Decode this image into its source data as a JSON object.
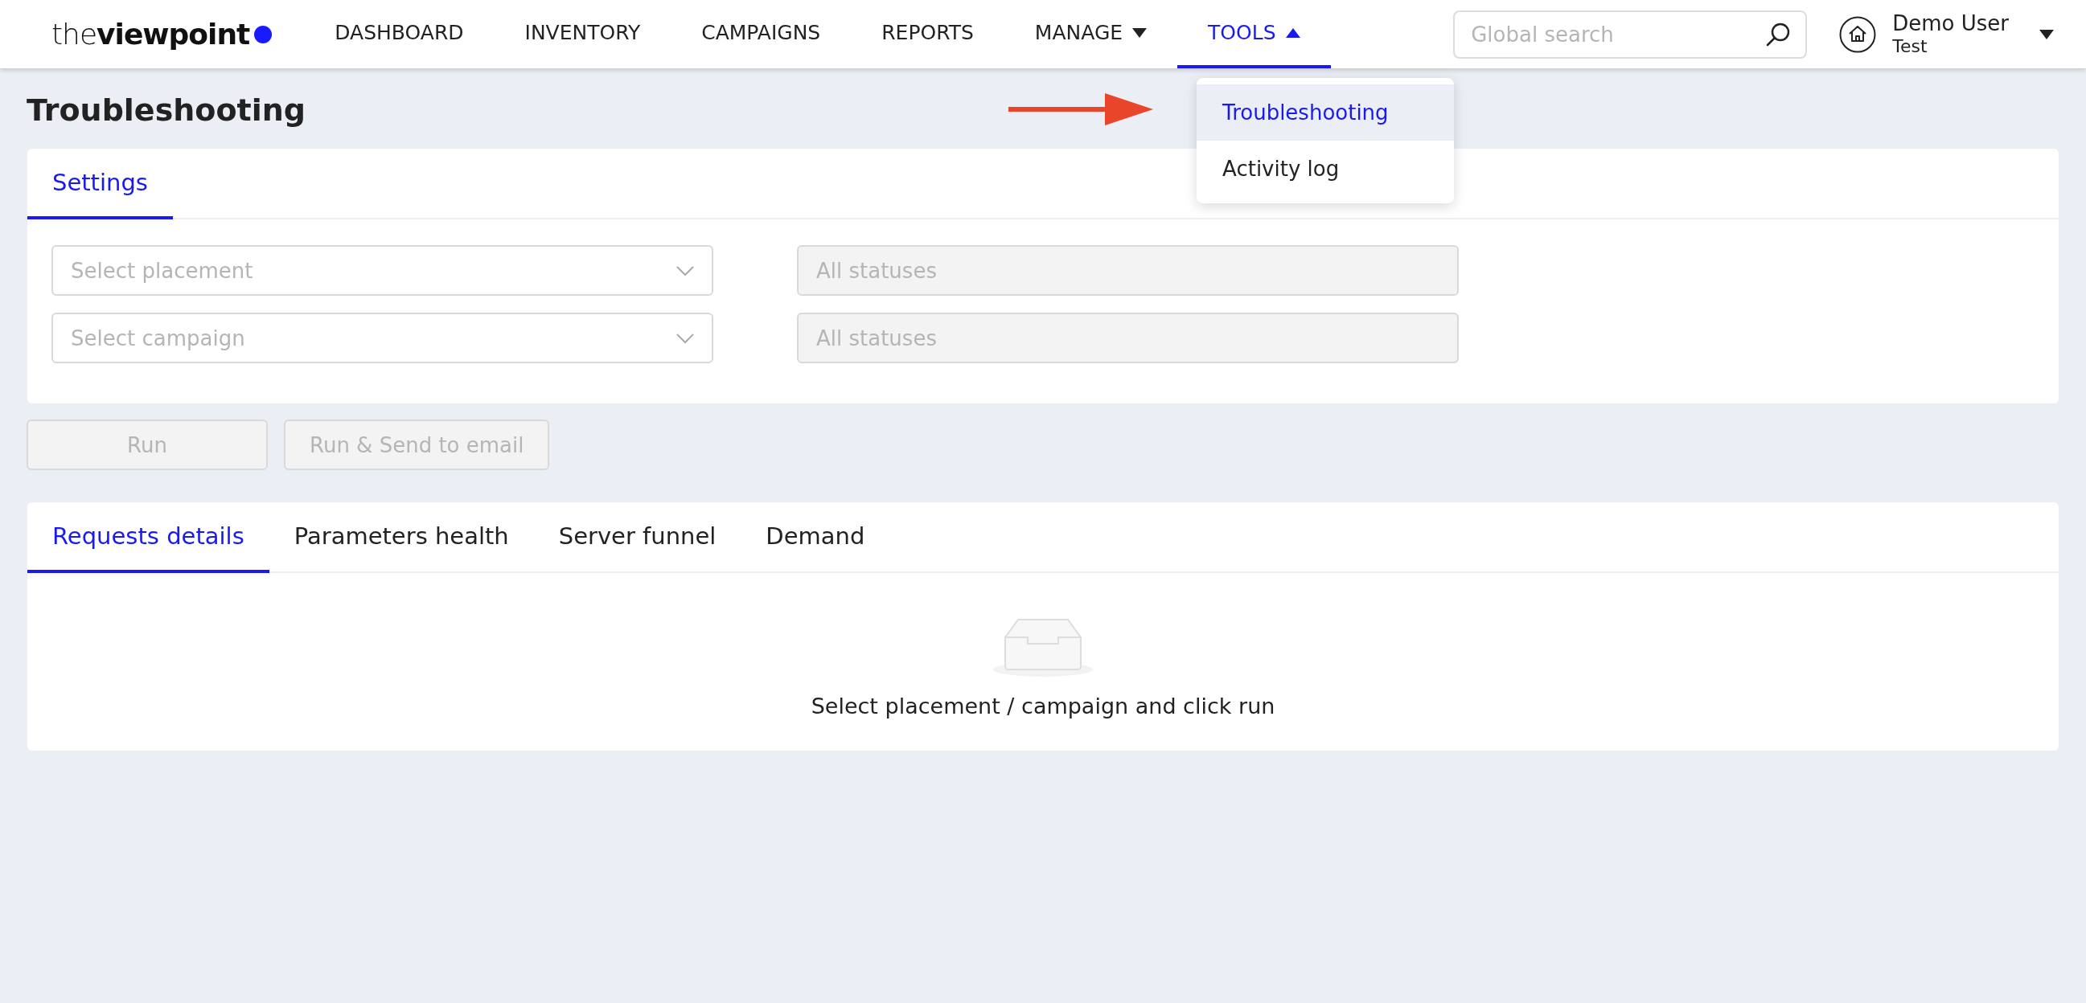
{
  "logo": "the**viewpoint**",
  "nav": [
    {
      "label": "DASHBOARD",
      "selected": false
    },
    {
      "label": "INVENTORY",
      "selected": false
    },
    {
      "label": "CAMPAIGNS",
      "selected": false
    },
    {
      "label": "REPORTS",
      "selected": false
    },
    {
      "label": "MANAGE",
      "selected": false,
      "expanded": false
    },
    {
      "label": "TOOLS",
      "selected": true,
      "expanded": true,
      "menu": {
        "expanded": true,
        "items": [
          {
            "label": "Troubleshooting",
            "selected": true
          },
          {
            "label": "Activity log",
            "selected": false
          }
        ]
      }
    }
  ],
  "search": {
    "placeholder": "Global search"
  },
  "user": {
    "name": "Demo User",
    "account": "Test"
  },
  "page_title": "Troubleshooting",
  "settings": {
    "tabs": [
      {
        "label": "Settings",
        "selected": true
      }
    ],
    "rows": [
      {
        "select": {
          "placeholder": "Select placement"
        },
        "status": {
          "placeholder": "All statuses",
          "disabled": true
        }
      },
      {
        "select": {
          "placeholder": "Select campaign"
        },
        "status": {
          "placeholder": "All statuses",
          "disabled": true
        }
      }
    ]
  },
  "buttons": [
    {
      "label": "Run",
      "disabled": true
    },
    {
      "label": "Run & Send to email",
      "disabled": true
    }
  ],
  "results": {
    "tabs": [
      {
        "label": "Requests details",
        "selected": true
      },
      {
        "label": "Parameters health",
        "selected": false
      },
      {
        "label": "Server funnel",
        "selected": false
      },
      {
        "label": "Demand",
        "selected": false
      }
    ],
    "empty_message": "Select placement / campaign and click run"
  }
}
